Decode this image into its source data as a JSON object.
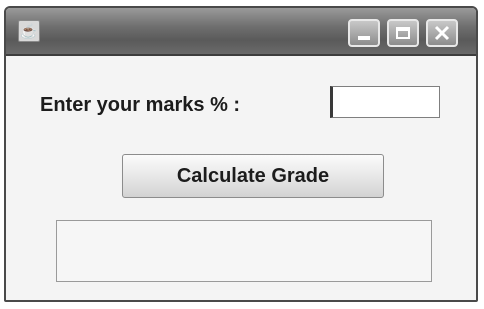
{
  "window": {
    "title": "",
    "icon": "java-coffee-cup-icon"
  },
  "title_buttons": {
    "minimize_icon": "minimize-icon",
    "maximize_icon": "maximize-icon",
    "close_icon": "close-icon"
  },
  "form": {
    "marks_label": "Enter your marks % :",
    "marks_value": "",
    "calculate_button_label": "Calculate Grade",
    "result_text": ""
  }
}
